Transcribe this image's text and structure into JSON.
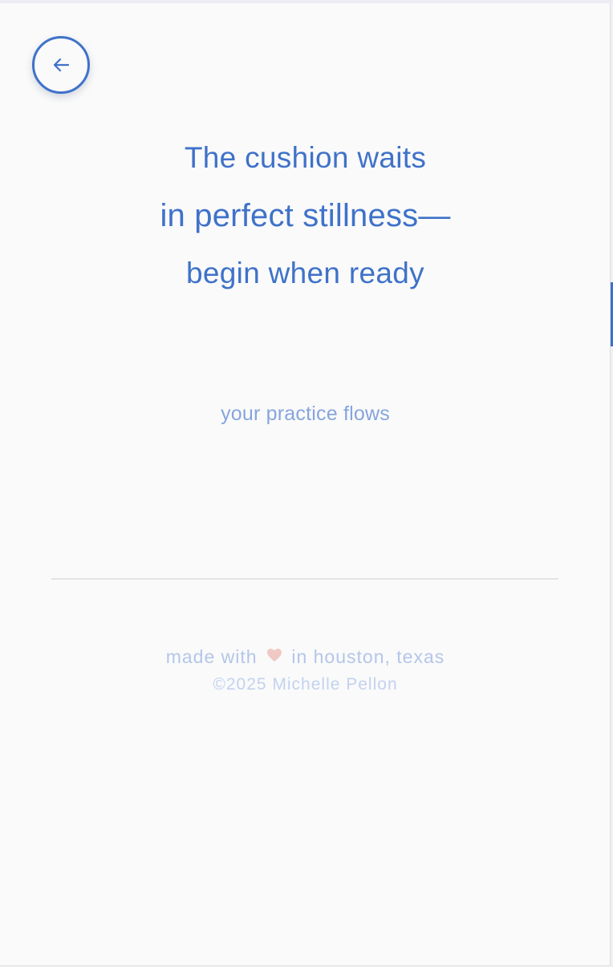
{
  "navigation": {
    "back_icon": "arrow-left-icon"
  },
  "hero": {
    "line1": "The cushion waits",
    "line2": "in perfect stillness—",
    "line3": "begin when ready"
  },
  "status": {
    "text": "your practice flows"
  },
  "footer": {
    "made_with_prefix": "made with",
    "heart_icon": "heart-icon",
    "made_with_suffix": "in houston, texas",
    "copyright": "©2025 Michelle Pellon"
  },
  "colors": {
    "accent": "#3f72c9",
    "subtle": "#86a5dd",
    "footer": "#b3c6ea",
    "heart": "#f0c8c4",
    "background": "#fafafa"
  }
}
